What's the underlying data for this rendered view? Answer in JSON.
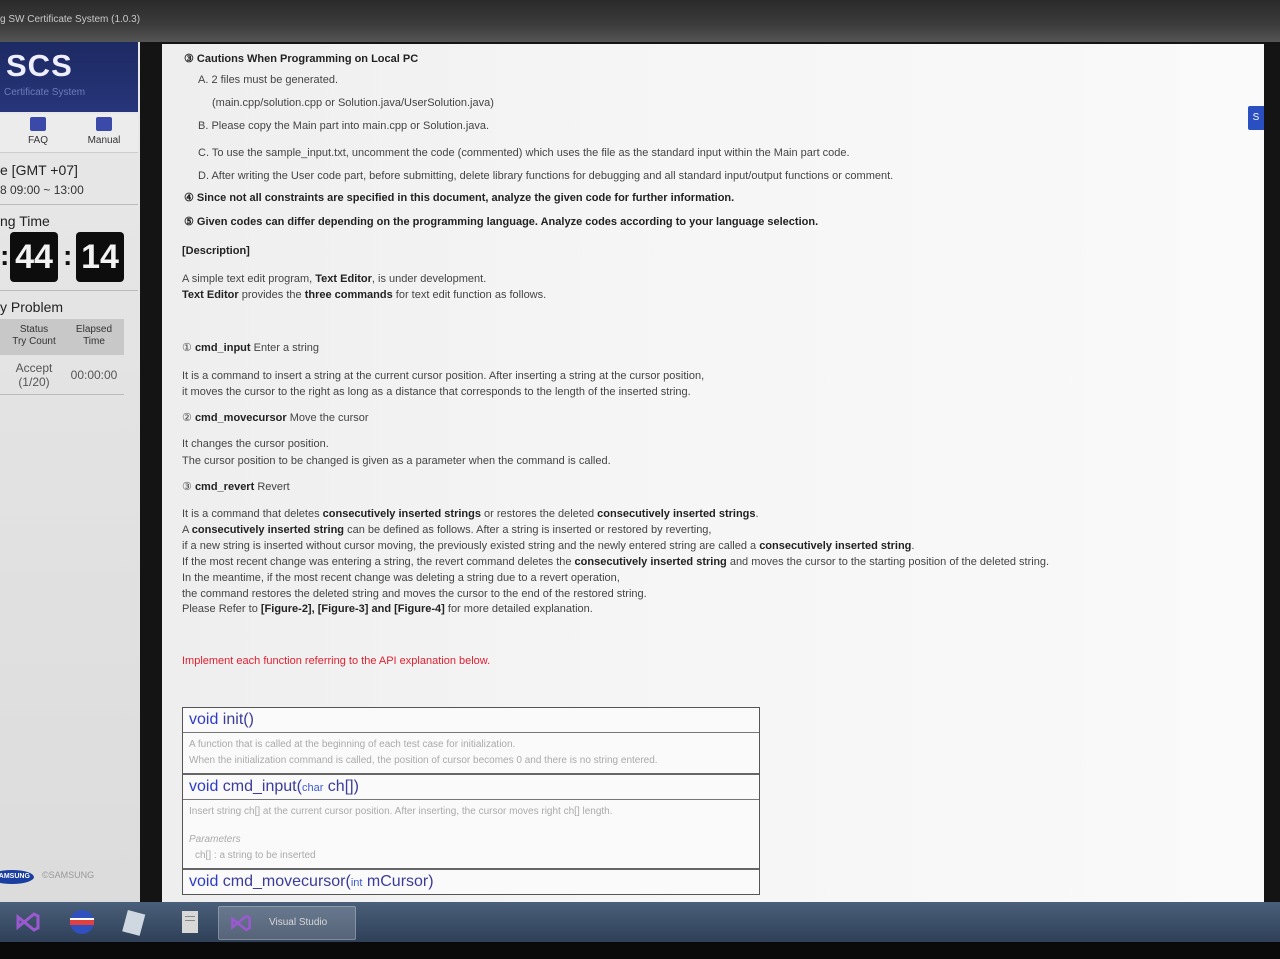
{
  "window": {
    "title": "g SW Certificate System (1.0.3)"
  },
  "sidebar": {
    "logo": "SCS",
    "logo_sub": "Certificate System",
    "nav": [
      {
        "label": "FAQ",
        "icon": "faq-icon"
      },
      {
        "label": "Manual",
        "icon": "manual-icon"
      }
    ],
    "timezone": "e [GMT +07]",
    "exam_time": "8 09:00 ~ 13:00",
    "remaining_label": "ng Time",
    "timer": {
      "minutes": "44",
      "seconds": "14"
    },
    "problem_label": "y Problem",
    "table_head": {
      "status": "Status\nTry Count",
      "elapsed": "Elapsed\nTime"
    },
    "row": {
      "status": "Accept\n(1/20)",
      "elapsed": "00:00:00"
    },
    "copyright": "©SAMSUNG",
    "samsung_logo": "SAMSUNG"
  },
  "content": {
    "cautions_title": "③ Cautions When Programming on Local PC",
    "a": "A. 2 files must be generated.",
    "a2": "(main.cpp/solution.cpp or Solution.java/UserSolution.java)",
    "b": "B. Please copy the Main part into main.cpp or Solution.java.",
    "c": "C. To use the sample_input.txt, uncomment the code (commented) which uses the file as the standard input within the Main part code.",
    "d": "D. After writing the User code part, before submitting, delete library functions for debugging and all standard input/output functions or comment.",
    "n4": "④ Since not all constraints are specified in this document, analyze the given code for further information.",
    "n5": "⑤ Given codes can differ depending on the programming language. Analyze codes according to your language selection.",
    "desc_title": "[Description]",
    "desc1_pre": "A simple text edit program, ",
    "desc1_b": "Text Editor",
    "desc1_post": ", is under development.",
    "desc2_b1": "Text Editor",
    "desc2_mid": " provides the ",
    "desc2_b2": "three commands",
    "desc2_post": " for text edit function as follows.",
    "cmd1_num": "①",
    "cmd1_name": "cmd_input",
    "cmd1_desc": "Enter a string",
    "cmd1_l1": "It is a command to insert a string at the current cursor position. After inserting a string at the cursor position,",
    "cmd1_l2": "it moves the cursor to the right as long as a distance that corresponds to the length of the inserted string.",
    "cmd2_num": "②",
    "cmd2_name": "cmd_movecursor",
    "cmd2_desc": "Move the cursor",
    "cmd2_l1": "It changes the cursor position.",
    "cmd2_l2": "The cursor position to be changed is given as a parameter when the command is called.",
    "cmd3_num": "③",
    "cmd3_name": "cmd_revert",
    "cmd3_desc": "Revert",
    "r1_pre": "It is a command that deletes ",
    "r1_b1": "consecutively inserted strings",
    "r1_mid": " or restores the deleted ",
    "r1_b2": "consecutively inserted strings",
    "r1_post": ".",
    "r2_pre": "A ",
    "r2_b": "consecutively inserted string",
    "r2_post": " can be defined as follows. After a string is inserted or restored by reverting,",
    "r3_pre": "if a new string is inserted without cursor moving, the previously existed string and the newly entered string are called a ",
    "r3_b": "consecutively inserted string",
    "r3_post": ".",
    "r4_pre": "If the most recent change was entering a string, the revert command deletes the ",
    "r4_b": "consecutively inserted string",
    "r4_post": " and moves the cursor to the starting position of the deleted string.",
    "r5": "In the meantime, if the most recent change was deleting a string due to a revert operation,",
    "r6": "the command restores the deleted string and moves the cursor to the end of the restored string.",
    "r7_pre": "Please Refer to ",
    "r7_b": "[Figure-2], [Figure-3] and [Figure-4]",
    "r7_post": " for more detailed explanation.",
    "implement": "Implement each function referring to the API explanation below.",
    "api": {
      "f1_kw": "void",
      "f1_name": " init()",
      "f1_l1": "A function that is called at the beginning of each test case for initialization.",
      "f1_l2": "When the initialization command is called, the position of cursor becomes 0 and there is no string entered.",
      "f2_kw": "void",
      "f2_name": " cmd_input(",
      "f2_type": "char",
      "f2_param": " ch[])",
      "f2_l1": "Insert string ch[] at the current cursor position. After inserting, the cursor moves right ch[] length.",
      "f2_params_label": "Parameters",
      "f2_params_l1": "ch[]  : a string to be inserted",
      "f3_kw": "void",
      "f3_name": " cmd_movecursor(",
      "f3_type": "int",
      "f3_param": " mCursor)"
    }
  },
  "taskbar": {
    "active_label": "Visual Studio"
  },
  "colors": {
    "accent_blue": "#27357a",
    "warning_red": "#e02030",
    "keyword_blue": "#2d3cc8"
  }
}
